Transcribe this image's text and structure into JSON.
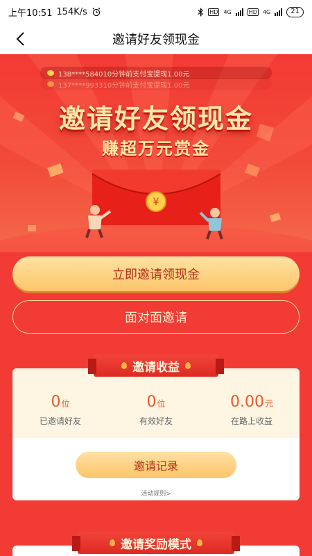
{
  "status": {
    "time": "上午10:51",
    "speed": "154K/s",
    "net1": "HD",
    "net2": "4G",
    "net3": "HD",
    "net4": "4G",
    "battery": "21"
  },
  "nav": {
    "title": "邀请好友领现金"
  },
  "hero": {
    "tickers": [
      "138****584010分钟前支付宝提现1.00元",
      "137****993310分钟前支付宝提现1.00元"
    ],
    "title": "邀请好友领现金",
    "subtitle": "赚超万元赏金",
    "coin_symbol": "¥"
  },
  "actions": {
    "invite_label": "立即邀请领现金",
    "face_invite_label": "面对面邀请"
  },
  "earnings": {
    "section_title": "邀请收益",
    "stats": [
      {
        "value": "0",
        "unit": "位",
        "label": "已邀请好友"
      },
      {
        "value": "0",
        "unit": "位",
        "label": "有效好友"
      },
      {
        "value": "0.00",
        "unit": "元",
        "label": "在路上收益"
      }
    ],
    "record_label": "邀请记录",
    "rules_label": "活动规则>"
  },
  "reward": {
    "section_title": "邀请奖励模式"
  },
  "colors": {
    "primary_red": "#f23b35",
    "gold": "#fcc56a",
    "title_gold": "#ffe7a8"
  }
}
